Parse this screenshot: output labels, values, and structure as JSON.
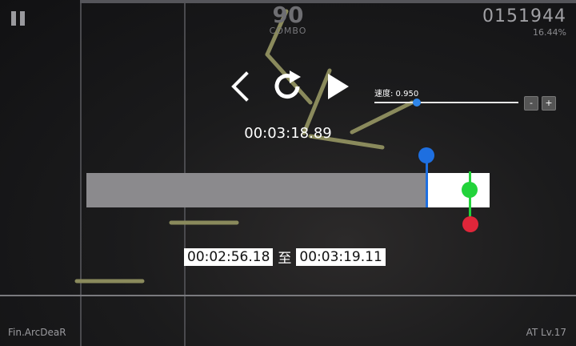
{
  "hud": {
    "combo": "90",
    "combo_label": "COMBO",
    "score": "0151944",
    "percent": "16.44%"
  },
  "player": {
    "current_time": "00:03:18.89",
    "speed_label": "速度: 0.950",
    "speed_value": 0.95,
    "minus_label": "-",
    "plus_label": "+"
  },
  "range": {
    "start": "00:02:56.18",
    "to_label": "至",
    "end": "00:03:19.11"
  },
  "footer": {
    "chart_name": "Fin.ArcDeaR",
    "difficulty": "AT Lv.17"
  },
  "colors": {
    "start_marker": "#1e6fe0",
    "current_marker": "#22d33a",
    "end_marker": "#e0263a",
    "note": "#8a8a5c"
  }
}
